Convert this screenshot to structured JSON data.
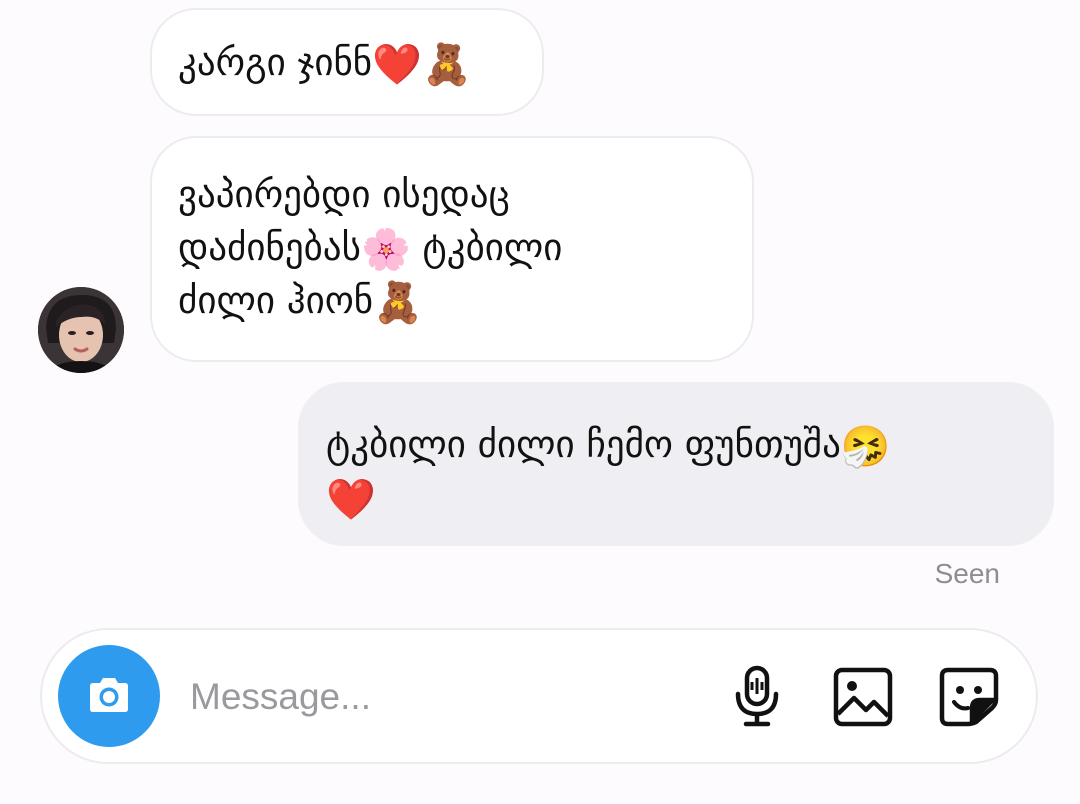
{
  "messages": [
    {
      "direction": "incoming",
      "lines": [
        {
          "text": "კარგი ჯინნ",
          "emoji": "❤️🧸"
        }
      ]
    },
    {
      "direction": "incoming",
      "lines": [
        {
          "text": "ვაპირებდი ისედაც",
          "emoji": ""
        },
        {
          "text": "დაძინებას",
          "emoji": "🌸",
          "tail": " ტკბილი"
        },
        {
          "text": "ძილი ჰიონ",
          "emoji": "🧸"
        }
      ]
    },
    {
      "direction": "outgoing",
      "lines": [
        {
          "text": "ტკბილი ძილი ჩემო ფუნთუშა",
          "emoji": "🤧"
        },
        {
          "text": "",
          "emoji": "❤️"
        }
      ]
    }
  ],
  "status": {
    "seen": "Seen"
  },
  "composer": {
    "placeholder": "Message..."
  },
  "icons": {
    "camera": "camera-icon",
    "microphone": "microphone-icon",
    "gallery": "image-icon",
    "sticker": "sticker-icon"
  },
  "colors": {
    "camera_button": "#2f9bef",
    "incoming_bubble": "#ffffff",
    "outgoing_bubble": "#efeef2",
    "seen_text": "#8e8e92"
  }
}
